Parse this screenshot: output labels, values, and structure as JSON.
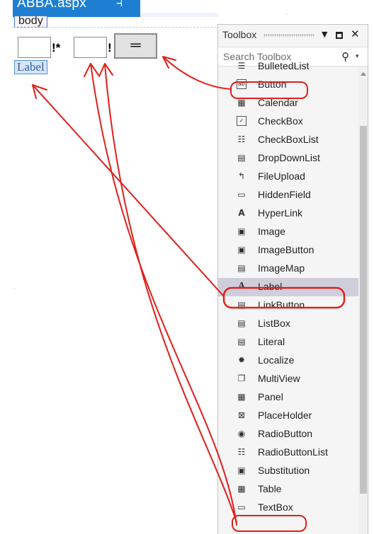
{
  "document": {
    "tab_title": "ABBA.aspx",
    "pin_glyph": "⊣",
    "body_tag": "body"
  },
  "design": {
    "operator_text_1": "!*",
    "operator_text_2": "!",
    "equals_button_label": "═",
    "label_text": "Label"
  },
  "toolbox": {
    "title": "Toolbox",
    "search_placeholder": "Search Toolbox",
    "items": [
      {
        "label": "BulletedList",
        "icon": "bulleted-list-icon",
        "glyph": "☰"
      },
      {
        "label": "Button",
        "icon": "button-icon",
        "glyph": "ab"
      },
      {
        "label": "Calendar",
        "icon": "calendar-icon",
        "glyph": "▦"
      },
      {
        "label": "CheckBox",
        "icon": "checkbox-icon",
        "glyph": "✓"
      },
      {
        "label": "CheckBoxList",
        "icon": "checkbox-list-icon",
        "glyph": "☷"
      },
      {
        "label": "DropDownList",
        "icon": "dropdown-list-icon",
        "glyph": "▤"
      },
      {
        "label": "FileUpload",
        "icon": "file-upload-icon",
        "glyph": "↰"
      },
      {
        "label": "HiddenField",
        "icon": "hidden-field-icon",
        "glyph": "▭"
      },
      {
        "label": "HyperLink",
        "icon": "hyperlink-icon",
        "glyph": "A"
      },
      {
        "label": "Image",
        "icon": "image-icon",
        "glyph": "▣"
      },
      {
        "label": "ImageButton",
        "icon": "image-button-icon",
        "glyph": "▣"
      },
      {
        "label": "ImageMap",
        "icon": "image-map-icon",
        "glyph": "▤"
      },
      {
        "label": "Label",
        "icon": "label-icon",
        "glyph": "A"
      },
      {
        "label": "LinkButton",
        "icon": "link-button-icon",
        "glyph": "▤"
      },
      {
        "label": "ListBox",
        "icon": "list-box-icon",
        "glyph": "▤"
      },
      {
        "label": "Literal",
        "icon": "literal-icon",
        "glyph": "▤"
      },
      {
        "label": "Localize",
        "icon": "localize-icon",
        "glyph": "✹"
      },
      {
        "label": "MultiView",
        "icon": "multiview-icon",
        "glyph": "❐"
      },
      {
        "label": "Panel",
        "icon": "panel-icon",
        "glyph": "▦"
      },
      {
        "label": "PlaceHolder",
        "icon": "placeholder-icon",
        "glyph": "⊠"
      },
      {
        "label": "RadioButton",
        "icon": "radio-button-icon",
        "glyph": "◉"
      },
      {
        "label": "RadioButtonList",
        "icon": "radio-button-list-icon",
        "glyph": "☷"
      },
      {
        "label": "Substitution",
        "icon": "substitution-icon",
        "glyph": "▣"
      },
      {
        "label": "Table",
        "icon": "table-icon",
        "glyph": "▦"
      },
      {
        "label": "TextBox",
        "icon": "textbox-icon",
        "glyph": "▭"
      }
    ],
    "selected_item": "Label"
  },
  "colors": {
    "tab_blue": "#1e7fd2",
    "annotation_red": "#e0201b",
    "selection": "#cfcfdc"
  }
}
